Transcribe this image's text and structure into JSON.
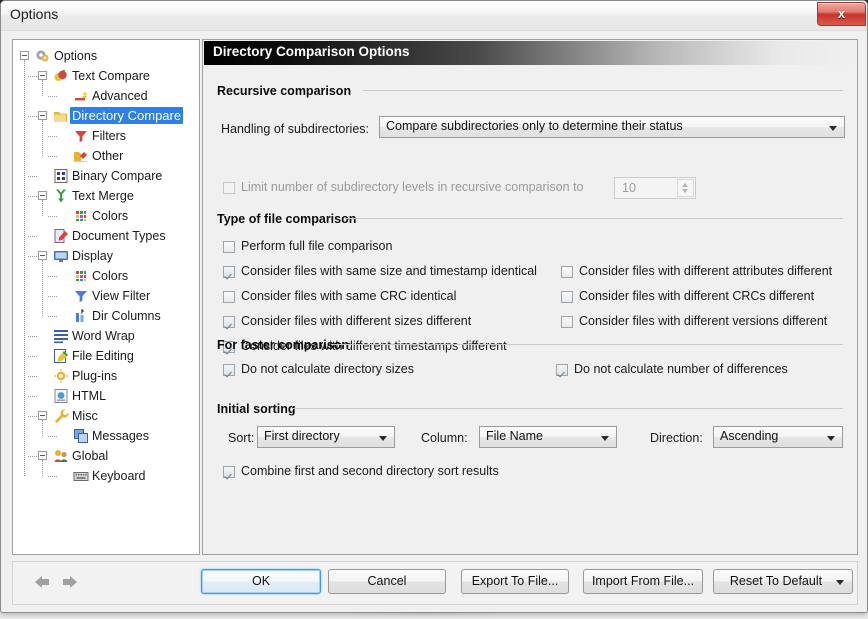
{
  "window": {
    "title": "Options",
    "close_label": "x"
  },
  "tree": {
    "items": [
      {
        "label": "Options",
        "icon": "gears-icon",
        "depth": 0,
        "expander": true,
        "selected": false
      },
      {
        "label": "Text Compare",
        "icon": "apples-icon",
        "depth": 1,
        "expander": true,
        "selected": false
      },
      {
        "label": "Advanced",
        "icon": "magic-wand-icon",
        "depth": 2,
        "expander": false,
        "selected": false
      },
      {
        "label": "Directory Compare",
        "icon": "folders-icon",
        "depth": 1,
        "expander": true,
        "selected": true
      },
      {
        "label": "Filters",
        "icon": "funnel-icon",
        "depth": 2,
        "expander": false,
        "selected": false
      },
      {
        "label": "Other",
        "icon": "folder-pencil-icon",
        "depth": 2,
        "expander": false,
        "selected": false
      },
      {
        "label": "Binary Compare",
        "icon": "binary-icon",
        "depth": 1,
        "expander": false,
        "selected": false
      },
      {
        "label": "Text Merge",
        "icon": "merge-y-icon",
        "depth": 1,
        "expander": true,
        "selected": false
      },
      {
        "label": "Colors",
        "icon": "palette-grid-icon",
        "depth": 2,
        "expander": false,
        "selected": false
      },
      {
        "label": "Document Types",
        "icon": "document-pencil-icon",
        "depth": 1,
        "expander": false,
        "selected": false
      },
      {
        "label": "Display",
        "icon": "monitor-icon",
        "depth": 1,
        "expander": true,
        "selected": false
      },
      {
        "label": "Colors",
        "icon": "palette-grid-icon",
        "depth": 2,
        "expander": false,
        "selected": false
      },
      {
        "label": "View Filter",
        "icon": "funnel-blue-icon",
        "depth": 2,
        "expander": false,
        "selected": false
      },
      {
        "label": "Dir Columns",
        "icon": "columns-icon",
        "depth": 2,
        "expander": false,
        "selected": false
      },
      {
        "label": "Word Wrap",
        "icon": "lines-icon",
        "depth": 1,
        "expander": false,
        "selected": false
      },
      {
        "label": "File Editing",
        "icon": "file-pencil-icon",
        "depth": 1,
        "expander": false,
        "selected": false
      },
      {
        "label": "Plug-ins",
        "icon": "sun-gear-icon",
        "depth": 1,
        "expander": false,
        "selected": false
      },
      {
        "label": "HTML",
        "icon": "html-page-icon",
        "depth": 1,
        "expander": false,
        "selected": false
      },
      {
        "label": "Misc",
        "icon": "wrench-icon",
        "depth": 1,
        "expander": true,
        "selected": false
      },
      {
        "label": "Messages",
        "icon": "windows-icon",
        "depth": 2,
        "expander": false,
        "selected": false
      },
      {
        "label": "Global",
        "icon": "people-icon",
        "depth": 1,
        "expander": true,
        "selected": false
      },
      {
        "label": "Keyboard",
        "icon": "keyboard-icon",
        "depth": 2,
        "expander": false,
        "selected": false
      }
    ]
  },
  "panel": {
    "title": "Directory Comparison Options",
    "groups": {
      "recursive": {
        "header": "Recursive comparison",
        "subdir_label": "Handling of subdirectories:",
        "subdir_value": "Compare subdirectories only to determine their status",
        "limit_label": "Limit number of subdirectory levels in recursive comparison to",
        "limit_checked": false,
        "limit_disabled": true,
        "limit_value": "10"
      },
      "file_type": {
        "header": "Type of file comparison",
        "left": [
          {
            "label": "Perform full file comparison",
            "checked": false
          },
          {
            "label": "Consider files with same size and timestamp identical",
            "checked": true
          },
          {
            "label": "Consider files with same CRC identical",
            "checked": false
          },
          {
            "label": "Consider files with different sizes different",
            "checked": true
          },
          {
            "label": "Consider files with different timestamps different",
            "checked": true
          }
        ],
        "right": [
          {
            "label": "Consider files with different attributes different",
            "checked": false
          },
          {
            "label": "Consider files with different CRCs different",
            "checked": false
          },
          {
            "label": "Consider files with different versions different",
            "checked": false
          }
        ]
      },
      "faster": {
        "header": "For faster comparison",
        "items": [
          {
            "label": "Do not calculate directory sizes",
            "checked": true
          },
          {
            "label": "Do not calculate number of differences",
            "checked": true
          }
        ]
      },
      "sorting": {
        "header": "Initial sorting",
        "sort_label": "Sort:",
        "sort_value": "First directory",
        "column_label": "Column:",
        "column_value": "File Name",
        "direction_label": "Direction:",
        "direction_value": "Ascending",
        "combine_label": "Combine first and second directory sort results",
        "combine_checked": true
      }
    }
  },
  "footer": {
    "buttons": [
      {
        "label": "OK",
        "primary": true
      },
      {
        "label": "Cancel",
        "primary": false
      },
      {
        "label": "Export To File...",
        "primary": false
      },
      {
        "label": "Import From File...",
        "primary": false
      },
      {
        "label": "Reset To Default",
        "primary": false,
        "dropdown": true
      }
    ]
  },
  "colors": {
    "selection_blue": "#2f7fe8",
    "panel_background": "#f0f0f0",
    "close_red": "#c8342a",
    "primary_button_border": "#3c9be0"
  }
}
